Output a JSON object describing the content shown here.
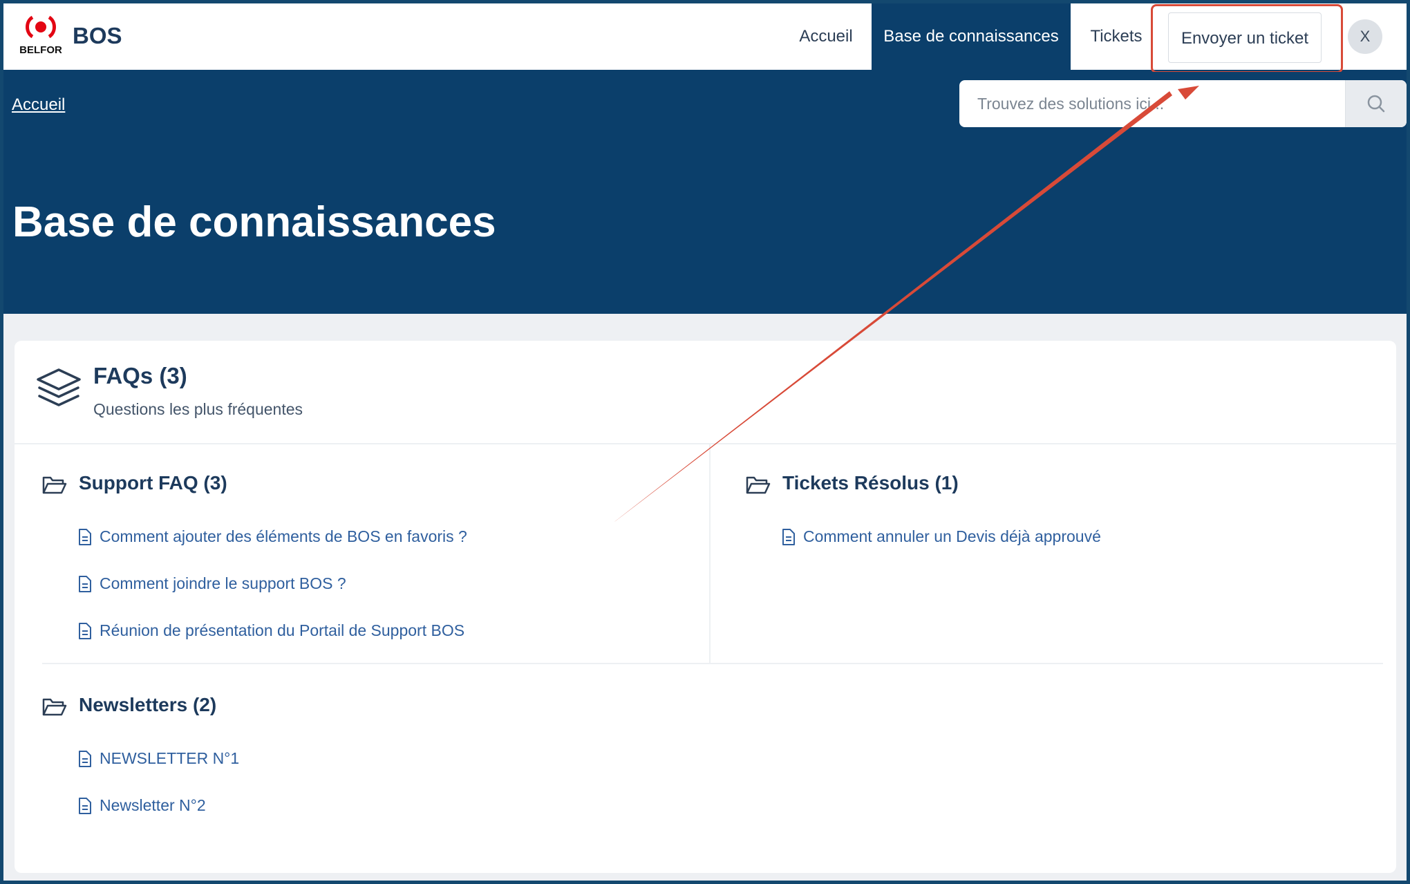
{
  "app": {
    "logo_text": "BELFOR",
    "name": "BOS"
  },
  "nav": {
    "home": "Accueil",
    "knowledge_base": "Base de connaissances",
    "tickets": "Tickets",
    "send_ticket": "Envoyer un ticket",
    "user_initial": "X"
  },
  "breadcrumb": {
    "home": "Accueil"
  },
  "search": {
    "placeholder": "Trouvez des solutions ici..."
  },
  "page": {
    "title": "Base de connaissances"
  },
  "faq_card": {
    "title": "FAQs (3)",
    "subtitle": "Questions les plus fréquentes",
    "folders": [
      {
        "title": "Support FAQ (3)",
        "articles": [
          "Comment ajouter des éléments de BOS en favoris ?",
          "Comment joindre le support BOS ?",
          "Réunion de présentation du Portail de Support BOS"
        ]
      },
      {
        "title": "Tickets Résolus (1)",
        "articles": [
          "Comment annuler un Devis déjà approuvé"
        ]
      },
      {
        "title": "Newsletters (2)",
        "articles": [
          "NEWSLETTER N°1",
          "Newsletter N°2"
        ]
      }
    ]
  },
  "colors": {
    "nav_active": "#0b3f6b",
    "hero_background": "#0b3f6b",
    "link": "#2f5f9e",
    "annotation": "#d84a38",
    "logo_red": "#e30613"
  }
}
